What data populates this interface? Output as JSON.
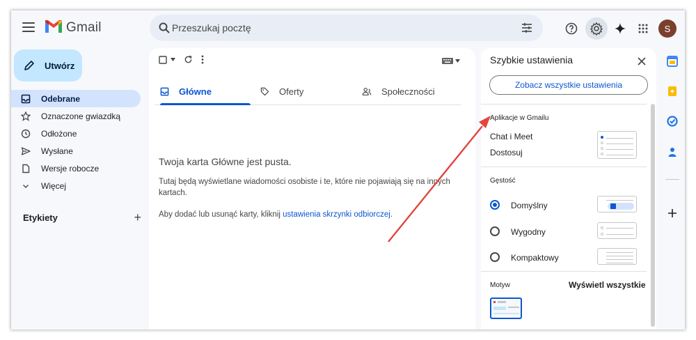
{
  "app": {
    "name": "Gmail"
  },
  "search": {
    "placeholder": "Przeszukaj pocztę"
  },
  "header": {
    "avatar_initial": "S"
  },
  "compose": {
    "label": "Utwórz"
  },
  "sidebar": {
    "items": [
      {
        "label": "Odebrane",
        "icon": "inbox-icon",
        "active": true
      },
      {
        "label": "Oznaczone gwiazdką",
        "icon": "star-icon"
      },
      {
        "label": "Odłożone",
        "icon": "clock-icon"
      },
      {
        "label": "Wysłane",
        "icon": "send-icon"
      },
      {
        "label": "Wersje robocze",
        "icon": "draft-icon"
      },
      {
        "label": "Więcej",
        "icon": "chevron-down-icon"
      }
    ],
    "labels_title": "Etykiety",
    "labels_add": "+"
  },
  "main": {
    "tabs": [
      {
        "label": "Główne",
        "icon": "inbox-icon",
        "active": true
      },
      {
        "label": "Oferty",
        "icon": "tag-icon"
      },
      {
        "label": "Społeczności",
        "icon": "people-icon"
      }
    ],
    "empty_title": "Twoja karta Główne jest pusta.",
    "empty_line1": "Tutaj będą wyświetlane wiadomości osobiste i te, które nie pojawiają się na innych kartach.",
    "empty_line2_prefix": "Aby dodać lub usunąć karty, kliknij ",
    "empty_line2_link": "ustawienia skrzynki odbiorczej",
    "empty_line2_suffix": "."
  },
  "quick_settings": {
    "title": "Szybkie ustawienia",
    "see_all": "Zobacz wszystkie ustawienia",
    "apps_section": "Aplikacje w Gmailu",
    "chat_meet": "Chat i Meet",
    "customize": "Dostosuj",
    "density_section": "Gęstość",
    "density_options": [
      {
        "label": "Domyślny",
        "selected": true
      },
      {
        "label": "Wygodny",
        "selected": false
      },
      {
        "label": "Kompaktowy",
        "selected": false
      }
    ],
    "theme_section": "Motyw",
    "theme_view_all": "Wyświetl wszystkie"
  },
  "colors": {
    "accent": "#0b57d0",
    "selected_bg": "#d3e3fd",
    "compose_bg": "#c2e7ff",
    "arrow": "#e0463f"
  }
}
